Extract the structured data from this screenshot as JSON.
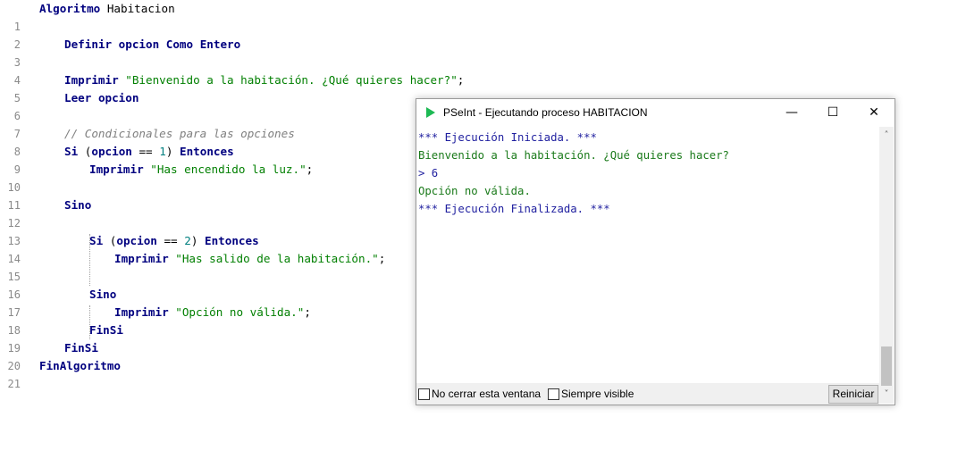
{
  "editor": {
    "line_numbers": [
      "1",
      "2",
      "3",
      "4",
      "5",
      "6",
      "7",
      "8",
      "9",
      "10",
      "11",
      "12",
      "13",
      "14",
      "15",
      "16",
      "17",
      "18",
      "19",
      "20",
      "21"
    ],
    "l1": {
      "kw": "Algoritmo",
      "name": "Habitacion"
    },
    "l3": {
      "kw1": "Definir",
      "id": "opcion",
      "kw2": "Como",
      "kw3": "Entero"
    },
    "l5": {
      "kw": "Imprimir",
      "str": "\"Bienvenido a la habitación. ¿Qué quieres hacer?\"",
      "end": ";"
    },
    "l6": {
      "kw": "Leer",
      "id": "opcion"
    },
    "l8": {
      "comment": "// Condicionales para las opciones"
    },
    "l9": {
      "kw": "Si",
      "open": "(",
      "id": "opcion",
      "op": "==",
      "num": "1",
      "close": ")",
      "kw2": "Entonces"
    },
    "l10": {
      "kw": "Imprimir",
      "str": "\"Has encendido la luz.\"",
      "end": ";"
    },
    "l12": {
      "kw": "Sino"
    },
    "l14": {
      "kw": "Si",
      "open": "(",
      "id": "opcion",
      "op": "==",
      "num": "2",
      "close": ")",
      "kw2": "Entonces"
    },
    "l15": {
      "kw": "Imprimir",
      "str": "\"Has salido de la habitación.\"",
      "end": ";"
    },
    "l17": {
      "kw": "Sino"
    },
    "l18": {
      "kw": "Imprimir",
      "str": "\"Opción no válida.\"",
      "end": ";"
    },
    "l19": {
      "kw": "FinSi"
    },
    "l20": {
      "kw": "FinSi"
    },
    "l21": {
      "kw": "FinAlgoritmo"
    }
  },
  "console_window": {
    "title": "PSeInt - Ejecutando proceso HABITACION",
    "minimize": "—",
    "maximize": "☐",
    "close": "✕",
    "lines": [
      "*** Ejecución Iniciada. ***",
      "Bienvenido a la habitación. ¿Qué quieres hacer?",
      "> 6",
      "Opción no válida.",
      "*** Ejecución Finalizada. ***"
    ],
    "checkbox_keep_open": "No cerrar esta ventana",
    "checkbox_always_visible": "Siempre visible",
    "restart_button": "Reiniciar",
    "scroll_up": "˄",
    "scroll_down": "˅",
    "colors": {
      "accent_icon": "#1db954",
      "text_blue": "#1f1f9f",
      "text_green": "#1a7a1a"
    }
  }
}
